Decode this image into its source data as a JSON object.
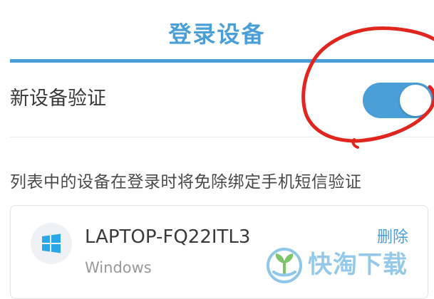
{
  "header": {
    "title": "登录设备"
  },
  "settings": {
    "new_device_verification_label": "新设备验证",
    "toggle_on": true
  },
  "description": "列表中的设备在登录时将免除绑定手机短信验证",
  "devices": [
    {
      "name": "LAPTOP-FQ22ITL3",
      "os": "Windows",
      "icon": "windows-icon",
      "delete_label": "删除"
    }
  ],
  "watermark": {
    "text": "快淘下载"
  },
  "colors": {
    "accent": "#4a9fd8",
    "annotation_red": "#e0261f"
  }
}
